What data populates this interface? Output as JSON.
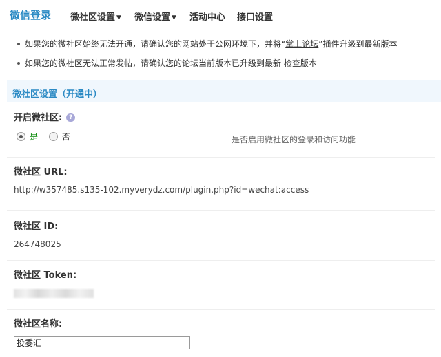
{
  "nav": {
    "brand": "微信登录",
    "items": [
      {
        "label": "微社区设置",
        "dropdown": true
      },
      {
        "label": "微信设置",
        "dropdown": true
      },
      {
        "label": "活动中心",
        "dropdown": false
      },
      {
        "label": "接口设置",
        "dropdown": false
      }
    ]
  },
  "tips": {
    "tip1_prefix": "如果您的微社区始终无法开通，请确认您的网站处于公网环境下，并将“",
    "tip1_link": "掌上论坛",
    "tip1_suffix": "”插件升级到最新版本",
    "tip2_prefix": "如果您的微社区无法正常发帖，请确认您的论坛当前版本已升级到最新",
    "tip2_link": "检查版本"
  },
  "section": {
    "title": "微社区设置（开通中）"
  },
  "form": {
    "enable": {
      "label": "开启微社区:",
      "help_icon": "?",
      "options": [
        "是",
        "否"
      ],
      "selected": "是",
      "hint": "是否启用微社区的登录和访问功能"
    },
    "url": {
      "label": "微社区 URL:",
      "value": "http://w357485.s135-102.myverydz.com/plugin.php?id=wechat:access"
    },
    "id": {
      "label": "微社区 ID:",
      "value": "264748025"
    },
    "token": {
      "label": "微社区 Token:"
    },
    "name": {
      "label": "微社区名称:",
      "value": "投委汇"
    }
  },
  "colors": {
    "brand": "#2b8ac4",
    "section_bg": "#f0f7fd",
    "radio_yes": "#0a8a0a"
  }
}
